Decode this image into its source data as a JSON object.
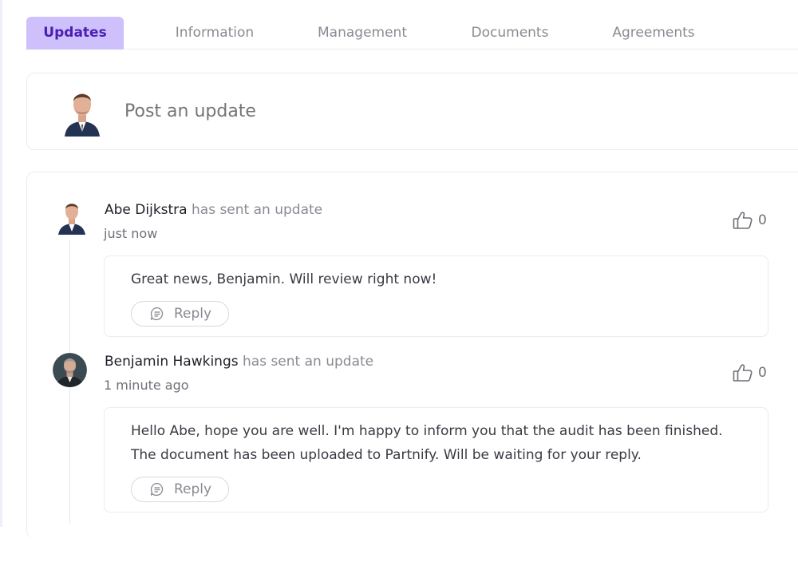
{
  "tabs": [
    {
      "label": "Updates",
      "active": true
    },
    {
      "label": "Information",
      "active": false
    },
    {
      "label": "Management",
      "active": false
    },
    {
      "label": "Documents",
      "active": false
    },
    {
      "label": "Agreements",
      "active": false
    }
  ],
  "composer": {
    "placeholder": "Post an update",
    "avatar": "user-avatar"
  },
  "updates": [
    {
      "author": "Abe Dijkstra",
      "action": "has sent an update",
      "time": "just now",
      "likes": "0",
      "message": "Great news, Benjamin. Will review right now!",
      "reply_label": "Reply",
      "avatar": "abe-avatar"
    },
    {
      "author": "Benjamin Hawkings",
      "action": "has sent an update",
      "time": "1 minute ago",
      "likes": "0",
      "message": "Hello Abe, hope you are well. I'm happy to inform you that the audit has been finished. The document has been uploaded to Partnify. Will be waiting for your reply.",
      "reply_label": "Reply",
      "avatar": "benjamin-avatar"
    }
  ],
  "colors": {
    "active_tab_bg": "#cdc0fb",
    "active_tab_text": "#4b1fb5",
    "muted_text": "#8a8a93",
    "border": "#ececf1"
  },
  "icons": {
    "like": "thumbs-up-icon",
    "reply": "chat-bubble-icon"
  }
}
